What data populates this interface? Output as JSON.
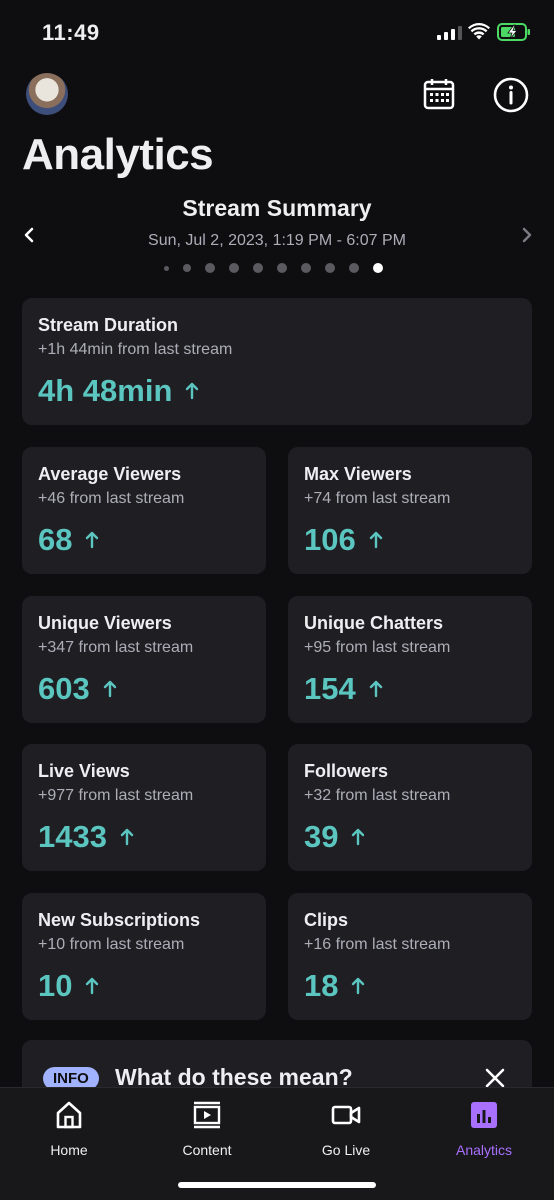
{
  "status_bar": {
    "time": "11:49"
  },
  "header": {
    "title": "Analytics"
  },
  "summary": {
    "title": "Stream Summary",
    "date": "Sun, Jul 2, 2023, 1:19 PM - 6:07 PM",
    "page_count": 10,
    "active_page": 10
  },
  "stats": {
    "duration": {
      "title": "Stream Duration",
      "sub": "+1h 44min from last stream",
      "value": "4h 48min"
    },
    "avg_viewers": {
      "title": "Average Viewers",
      "sub": "+46 from last stream",
      "value": "68"
    },
    "max_viewers": {
      "title": "Max Viewers",
      "sub": "+74 from last stream",
      "value": "106"
    },
    "unique_viewers": {
      "title": "Unique Viewers",
      "sub": "+347 from last stream",
      "value": "603"
    },
    "unique_chatters": {
      "title": "Unique Chatters",
      "sub": "+95 from last stream",
      "value": "154"
    },
    "live_views": {
      "title": "Live Views",
      "sub": "+977 from last stream",
      "value": "1433"
    },
    "followers": {
      "title": "Followers",
      "sub": "+32 from last stream",
      "value": "39"
    },
    "new_subs": {
      "title": "New Subscriptions",
      "sub": "+10 from last stream",
      "value": "10"
    },
    "clips": {
      "title": "Clips",
      "sub": "+16 from last stream",
      "value": "18"
    }
  },
  "info_banner": {
    "badge": "INFO",
    "heading": "What do these mean?"
  },
  "nav": {
    "home": "Home",
    "content": "Content",
    "go_live": "Go Live",
    "analytics": "Analytics"
  },
  "colors": {
    "background": "#0e0e10",
    "card": "#1f1f23",
    "value_teal": "#5bc5c0",
    "accent_purple": "#a970ff",
    "info_badge": "#a1b3ff",
    "battery_green": "#4cd964"
  }
}
